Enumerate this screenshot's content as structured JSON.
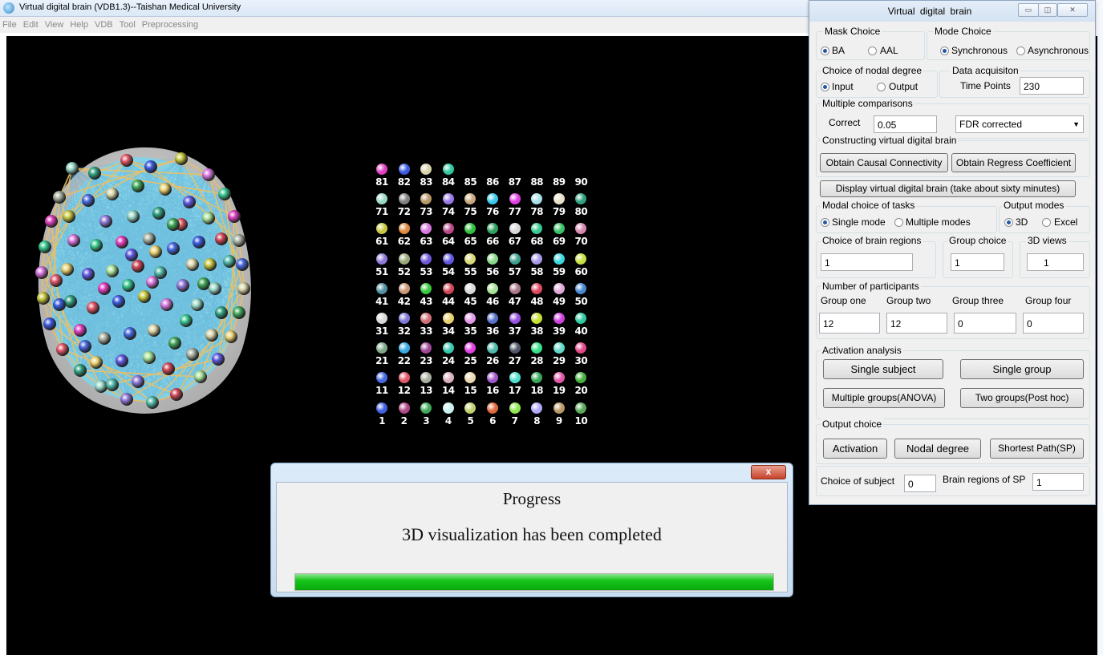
{
  "app": {
    "title": "Virtual digital brain (VDB1.3)--Taishan Medical University",
    "menu": [
      "File",
      "Edit",
      "View",
      "Help",
      "VDB",
      "Tool",
      "Preprocessing"
    ]
  },
  "node_grid": {
    "rows": [
      [
        "81",
        "82",
        "83",
        "84",
        "85",
        "86",
        "87",
        "88",
        "89",
        "90"
      ],
      [
        "71",
        "72",
        "73",
        "74",
        "75",
        "76",
        "77",
        "78",
        "79",
        "80"
      ],
      [
        "61",
        "62",
        "63",
        "64",
        "65",
        "66",
        "67",
        "68",
        "69",
        "70"
      ],
      [
        "51",
        "52",
        "53",
        "54",
        "55",
        "56",
        "57",
        "58",
        "59",
        "60"
      ],
      [
        "41",
        "42",
        "43",
        "44",
        "45",
        "46",
        "47",
        "48",
        "49",
        "50"
      ],
      [
        "31",
        "32",
        "33",
        "34",
        "35",
        "36",
        "37",
        "38",
        "39",
        "40"
      ],
      [
        "21",
        "22",
        "23",
        "24",
        "25",
        "26",
        "27",
        "28",
        "29",
        "30"
      ],
      [
        "11",
        "12",
        "13",
        "14",
        "15",
        "16",
        "17",
        "18",
        "19",
        "20"
      ],
      [
        "1",
        "2",
        "3",
        "4",
        "5",
        "6",
        "7",
        "8",
        "9",
        "10"
      ]
    ],
    "colors": [
      [
        "#e040c0",
        "#3c5be0",
        "#d8d4a8",
        "#30c8a0",
        null,
        null,
        null,
        null,
        null,
        null
      ],
      [
        "#9ad8c8",
        "#808080",
        "#b89868",
        "#9878e8",
        "#c8a880",
        "#3cc8e8",
        "#e040e0",
        "#a8e0e8",
        "#e8e0c8",
        "#30a080"
      ],
      [
        "#c8c840",
        "#e08840",
        "#d878e0",
        "#b84888",
        "#30c040",
        "#30a060",
        "#d8d8d8",
        "#38c890",
        "#38c068",
        "#d888b0"
      ],
      [
        "#9078d8",
        "#98a878",
        "#7058d8",
        "#6058e0",
        "#d8d878",
        "#88d888",
        "#40a090",
        "#a898e8",
        "#38d8e0",
        "#c8e040"
      ],
      [
        "#5090a0",
        "#c89878",
        "#38c840",
        "#d04858",
        "#d8d8d8",
        "#a8e098",
        "#a87888",
        "#e04860",
        "#e0a8d8",
        "#4888d0"
      ],
      [
        "#d8d8d8",
        "#8078d8",
        "#d07078",
        "#e8d070",
        "#e098e8",
        "#5870c8",
        "#9850e0",
        "#c8e030",
        "#d040e0",
        "#30c8a0"
      ],
      [
        "#80a888",
        "#38a8e0",
        "#a04898",
        "#38c8b0",
        "#e040e0",
        "#50b8a8",
        "#505868",
        "#38e088",
        "#60d8c8",
        "#e04888"
      ],
      [
        "#4868e0",
        "#e05868",
        "#a8b0a0",
        "#d8b0c0",
        "#e8d8b0",
        "#a058c8",
        "#50e0d0",
        "#38a858",
        "#e058a8",
        "#48b040"
      ],
      [
        "#4060e0",
        "#b04888",
        "#40a858",
        "#c8f0f0",
        "#c0d070",
        "#e06840",
        "#90e850",
        "#b0a8f8",
        "#b89868",
        "#58a858"
      ]
    ]
  },
  "progress_dialog": {
    "close_label": "x",
    "title": "Progress",
    "message": "3D visualization has been completed",
    "progress_fraction": 1.0
  },
  "control_panel": {
    "title": "Virtual  digital  brain",
    "window_buttons": [
      "▭",
      "◫",
      "✕"
    ],
    "mask_choice": {
      "label": "Mask Choice",
      "options": [
        "BA",
        "AAL"
      ],
      "selected": 0
    },
    "mode_choice": {
      "label": "Mode Choice",
      "options": [
        "Synchronous",
        "Asynchronous"
      ],
      "selected": 0
    },
    "nodal_degree": {
      "label": "Choice of nodal degree",
      "options": [
        "Input",
        "Output"
      ],
      "selected": 0
    },
    "data_acquisition": {
      "label": "Data acquisiton",
      "field_label": "Time Points",
      "value": "230"
    },
    "multiple_comparisons": {
      "label": "Multiple comparisons",
      "correct_label": "Correct",
      "correct_value": "0.05",
      "method": "FDR corrected"
    },
    "constructing": {
      "label": "Constructing virtual digital brain",
      "causal_button": "Obtain  Causal Connectivity",
      "regress_button": "Obtain Regress Coefficient"
    },
    "display_button": "Display virtual digital brain (take about sixty minutes)",
    "modal_tasks": {
      "label": "Modal choice of tasks",
      "options": [
        "Single mode",
        "Multiple modes"
      ],
      "selected": 0
    },
    "output_modes": {
      "label": "Output modes",
      "options": [
        "3D",
        "Excel"
      ],
      "selected": 0
    },
    "brain_regions": {
      "label": "Choice of brain regions",
      "value": "1"
    },
    "group_choice": {
      "label": "Group choice",
      "value": "1"
    },
    "views_3d": {
      "label": "3D views",
      "value": "1"
    },
    "participants": {
      "label": "Number of participants",
      "groups": [
        {
          "label": "Group one",
          "value": "12"
        },
        {
          "label": "Group two",
          "value": "12"
        },
        {
          "label": "Group three",
          "value": "0"
        },
        {
          "label": "Group four",
          "value": "0"
        }
      ]
    },
    "activation": {
      "label": "Activation analysis",
      "single_subject": "Single subject",
      "single_group": "Single group",
      "multiple_groups": "Multiple groups(ANOVA)",
      "two_groups": "Two groups(Post hoc)"
    },
    "output_choice": {
      "label": "Output choice",
      "activation": "Activation",
      "nodal_degree": "Nodal degree",
      "shortest_path": "Shortest Path(SP)"
    },
    "subject_choice": {
      "label": "Choice of subject",
      "value": "0"
    },
    "sp_regions": {
      "label": "Brain regions of SP",
      "value": "1"
    }
  }
}
